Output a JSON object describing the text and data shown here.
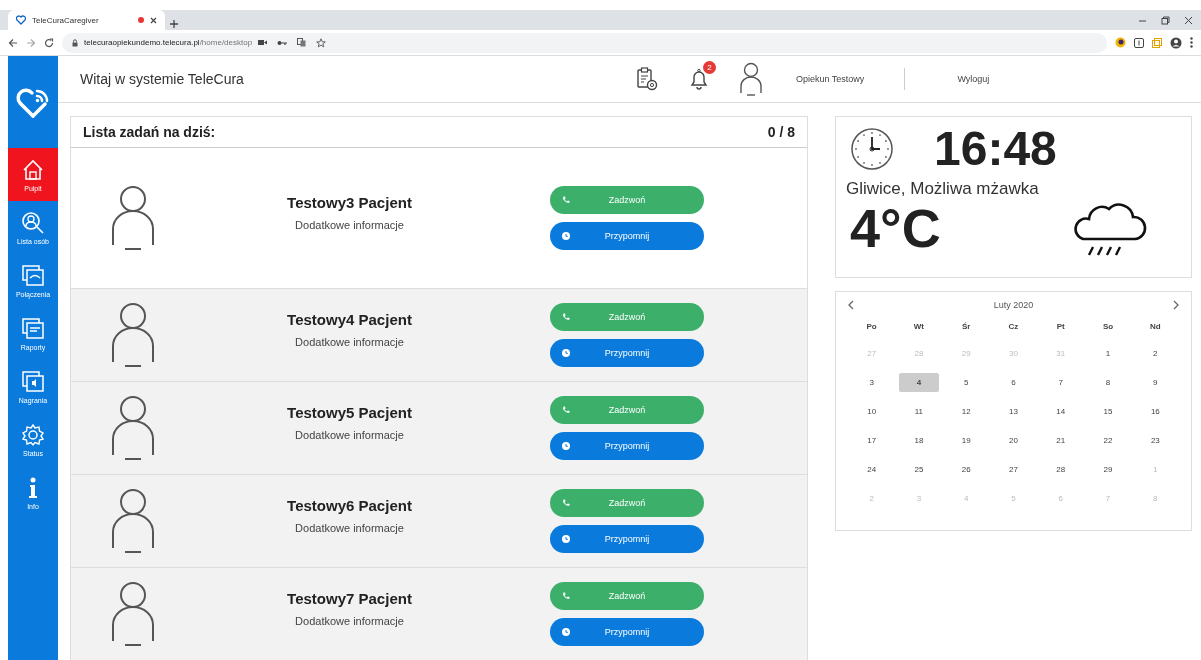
{
  "browser": {
    "tab_title": "TeleCuraCaregiver",
    "recording": true,
    "url_host": "telecuraopiekundemo.telecura.pl",
    "url_path": "/home/desktop"
  },
  "header": {
    "title": "Witaj w systemie TeleCura",
    "notifications": "2",
    "user": "Opiekun Testowy",
    "logout": "Wyloguj"
  },
  "sidebar": {
    "items": [
      {
        "kind": "home",
        "label": "Pulpit",
        "selected": true
      },
      {
        "kind": "search",
        "label": "Lista osób",
        "selected": false
      },
      {
        "kind": "calls",
        "label": "Połączenia",
        "selected": false
      },
      {
        "kind": "reports",
        "label": "Raporty",
        "selected": false
      },
      {
        "kind": "recordings",
        "label": "Nagrania",
        "selected": false
      },
      {
        "kind": "gear",
        "label": "Status",
        "selected": false
      },
      {
        "kind": "info",
        "label": "Info",
        "selected": false
      }
    ]
  },
  "tasks": {
    "title": "Lista zadań na dziś:",
    "count": "0 / 8",
    "rows": [
      {
        "name": "Testowy3 Pacjent",
        "info": "Dodatkowe informacje",
        "call": "Zadzwoń",
        "remind": "Przypomnij",
        "selected": true
      },
      {
        "name": "Testowy4 Pacjent",
        "info": "Dodatkowe informacje",
        "call": "Zadzwoń",
        "remind": "Przypomnij",
        "selected": false
      },
      {
        "name": "Testowy5 Pacjent",
        "info": "Dodatkowe informacje",
        "call": "Zadzwoń",
        "remind": "Przypomnij",
        "selected": false
      },
      {
        "name": "Testowy6 Pacjent",
        "info": "Dodatkowe informacje",
        "call": "Zadzwoń",
        "remind": "Przypomnij",
        "selected": false
      },
      {
        "name": "Testowy7 Pacjent",
        "info": "Dodatkowe informacje",
        "call": "Zadzwoń",
        "remind": "Przypomnij",
        "selected": false
      }
    ]
  },
  "weather": {
    "time": "16:48",
    "location": "Gliwice, Możliwa mżawka",
    "temperature": "4°C"
  },
  "calendar": {
    "month": "Luty 2020",
    "weekdays": [
      "Po",
      "Wt",
      "Śr",
      "Cz",
      "Pt",
      "So",
      "Nd"
    ],
    "days": [
      {
        "label": "27",
        "muted": true,
        "selected": false
      },
      {
        "label": "28",
        "muted": true,
        "selected": false
      },
      {
        "label": "29",
        "muted": true,
        "selected": false
      },
      {
        "label": "30",
        "muted": true,
        "selected": false
      },
      {
        "label": "31",
        "muted": true,
        "selected": false
      },
      {
        "label": "1",
        "muted": false,
        "selected": false
      },
      {
        "label": "2",
        "muted": false,
        "selected": false
      },
      {
        "label": "3",
        "muted": false,
        "selected": false
      },
      {
        "label": "4",
        "muted": false,
        "selected": true
      },
      {
        "label": "5",
        "muted": false,
        "selected": false
      },
      {
        "label": "6",
        "muted": false,
        "selected": false
      },
      {
        "label": "7",
        "muted": false,
        "selected": false
      },
      {
        "label": "8",
        "muted": false,
        "selected": false
      },
      {
        "label": "9",
        "muted": false,
        "selected": false
      },
      {
        "label": "10",
        "muted": false,
        "selected": false
      },
      {
        "label": "11",
        "muted": false,
        "selected": false
      },
      {
        "label": "12",
        "muted": false,
        "selected": false
      },
      {
        "label": "13",
        "muted": false,
        "selected": false
      },
      {
        "label": "14",
        "muted": false,
        "selected": false
      },
      {
        "label": "15",
        "muted": false,
        "selected": false
      },
      {
        "label": "16",
        "muted": false,
        "selected": false
      },
      {
        "label": "17",
        "muted": false,
        "selected": false
      },
      {
        "label": "18",
        "muted": false,
        "selected": false
      },
      {
        "label": "19",
        "muted": false,
        "selected": false
      },
      {
        "label": "20",
        "muted": false,
        "selected": false
      },
      {
        "label": "21",
        "muted": false,
        "selected": false
      },
      {
        "label": "22",
        "muted": false,
        "selected": false
      },
      {
        "label": "23",
        "muted": false,
        "selected": false
      },
      {
        "label": "24",
        "muted": false,
        "selected": false
      },
      {
        "label": "25",
        "muted": false,
        "selected": false
      },
      {
        "label": "26",
        "muted": false,
        "selected": false
      },
      {
        "label": "27",
        "muted": false,
        "selected": false
      },
      {
        "label": "28",
        "muted": false,
        "selected": false
      },
      {
        "label": "29",
        "muted": false,
        "selected": false
      },
      {
        "label": "1",
        "muted": true,
        "selected": false
      },
      {
        "label": "2",
        "muted": true,
        "selected": false
      },
      {
        "label": "3",
        "muted": true,
        "selected": false
      },
      {
        "label": "4",
        "muted": true,
        "selected": false
      },
      {
        "label": "5",
        "muted": true,
        "selected": false
      },
      {
        "label": "6",
        "muted": true,
        "selected": false
      },
      {
        "label": "7",
        "muted": true,
        "selected": false
      },
      {
        "label": "8",
        "muted": true,
        "selected": false
      }
    ]
  }
}
